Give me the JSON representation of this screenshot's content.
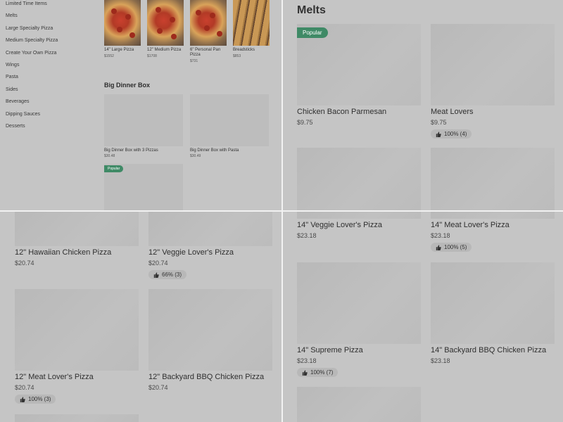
{
  "sidebar": {
    "items": [
      "Limited Time Items",
      "Melts",
      "Large Specialty Pizza",
      "Medium Specialty Pizza",
      "Create Your Own Pizza",
      "Wings",
      "Pasta",
      "Sides",
      "Beverages",
      "Dipping Sauces",
      "Desserts"
    ]
  },
  "top_row": [
    {
      "name": "14\" Large Pizza",
      "price": "$1552"
    },
    {
      "name": "12\" Medium Pizza",
      "price": "$1708"
    },
    {
      "name": "6\" Personal Pan Pizza",
      "price": "$731"
    },
    {
      "name": "Breadsticks",
      "price": "$853"
    }
  ],
  "big_dinner": {
    "title": "Big Dinner Box",
    "items": [
      {
        "name": "Big Dinner Box with 3 Pizzas",
        "price": "$30.48"
      },
      {
        "name": "Big Dinner Box with Pasta",
        "price": "$30.49"
      }
    ],
    "popular_badge": "Popular"
  },
  "melts": {
    "title": "Melts",
    "popular_badge": "Popular",
    "items": [
      {
        "name": "Chicken Bacon Parmesan",
        "price": "$9.75"
      },
      {
        "name": "Meat Lovers",
        "price": "$9.75",
        "rating": "100% (4)"
      }
    ]
  },
  "q3": {
    "items": [
      {
        "name": "12\" Hawaiian Chicken Pizza",
        "price": "$20.74"
      },
      {
        "name": "12\" Veggie Lover's Pizza",
        "price": "$20.74",
        "rating": "66% (3)"
      },
      {
        "name": "12\" Meat Lover's Pizza",
        "price": "$20.74",
        "rating": "100% (3)"
      },
      {
        "name": "12\" Backyard BBQ Chicken Pizza",
        "price": "$20.74"
      }
    ]
  },
  "q4": {
    "items": [
      {
        "name": "14\" Veggie Lover's Pizza",
        "price": "$23.18"
      },
      {
        "name": "14\" Meat Lover's Pizza",
        "price": "$23.18",
        "rating": "100% (5)"
      },
      {
        "name": "14\" Supreme Pizza",
        "price": "$23.18",
        "rating": "100% (7)"
      },
      {
        "name": "14\" Backyard BBQ Chicken Pizza",
        "price": "$23.18"
      }
    ]
  }
}
